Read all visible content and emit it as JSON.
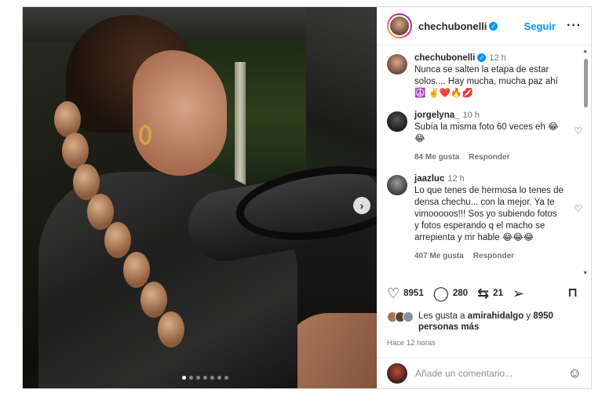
{
  "post": {
    "username": "chechubonelli",
    "follow_label": "Seguir",
    "more_label": "···",
    "slide_count": 7,
    "active_slide": 1
  },
  "comments": [
    {
      "user": "chechubonelli",
      "time": "12 h",
      "text": "Nunca se salten la etapa de estar solos.... Hay mucha, mucha paz ahí ☮️ ✌️❤️🔥💋",
      "likes": "",
      "reply": ""
    },
    {
      "user": "jorgelyna_",
      "time": "10 h",
      "text": "Subía la misma foto 60 veces eh 😂 😂",
      "likes": "84 Me gusta",
      "reply": "Responder"
    },
    {
      "user": "jaazluc",
      "time": "12 h",
      "text": "Lo que tenes de hermosa lo tenes de densa chechu... con la mejor. Ya te vimooooos!!! Sos yo subiendo fotos y fotos esperando q el macho se arrepienta y mr hable 😂😂😂",
      "likes": "407 Me gusta",
      "reply": "Responder"
    }
  ],
  "actions": {
    "likes_count": "8951",
    "comments_count": "280",
    "reposts_count": "21"
  },
  "liked_by": {
    "prefix": "Les gusta a ",
    "user": "amirahidalgo",
    "middle": " y ",
    "others": "8950 personas más"
  },
  "time_ago": "Hace 12 horas",
  "add_comment": {
    "placeholder": "Añade un comentario..."
  }
}
